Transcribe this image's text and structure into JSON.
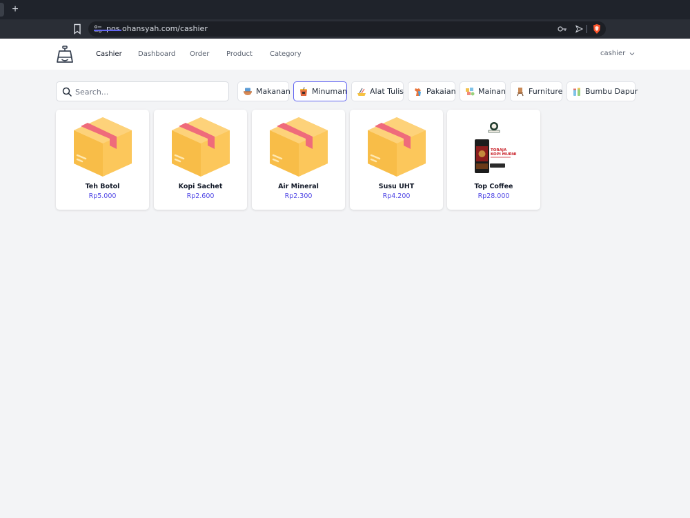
{
  "browser": {
    "newtab_label": "+",
    "url": "pos.ohansyah.com/cashier"
  },
  "header": {
    "nav": [
      {
        "label": "Cashier",
        "active": true
      },
      {
        "label": "Dashboard"
      },
      {
        "label": "Order"
      },
      {
        "label": "Product"
      },
      {
        "label": "Category"
      }
    ],
    "user_label": "cashier"
  },
  "search": {
    "placeholder": "Search..."
  },
  "categories": [
    {
      "label": "Makanan",
      "icon": "bowl-food-icon"
    },
    {
      "label": "Minuman",
      "icon": "drink-icon",
      "active": true
    },
    {
      "label": "Alat Tulis",
      "icon": "stationery-icon"
    },
    {
      "label": "Pakaian",
      "icon": "clothes-icon"
    },
    {
      "label": "Mainan",
      "icon": "toys-icon"
    },
    {
      "label": "Furniture",
      "icon": "furniture-icon"
    },
    {
      "label": "Bumbu Dapur",
      "icon": "spice-icon"
    }
  ],
  "products": [
    {
      "name": "Teh Botol",
      "price": "Rp5.000",
      "image": "box-icon"
    },
    {
      "name": "Kopi Sachet",
      "price": "Rp2.600",
      "image": "box-icon"
    },
    {
      "name": "Air Mineral",
      "price": "Rp2.300",
      "image": "box-icon"
    },
    {
      "name": "Susu UHT",
      "price": "Rp4.200",
      "image": "box-icon"
    },
    {
      "name": "Top Coffee",
      "price": "Rp28.000",
      "image": "coffee-pack-image"
    }
  ],
  "colors": {
    "accent": "#6366f1",
    "price": "#4f46e5",
    "box": "#fcc75b",
    "box_tape": "#ef6b7b"
  },
  "coffee_pack_text": [
    "TORAJA",
    "KOPI MURNI"
  ]
}
